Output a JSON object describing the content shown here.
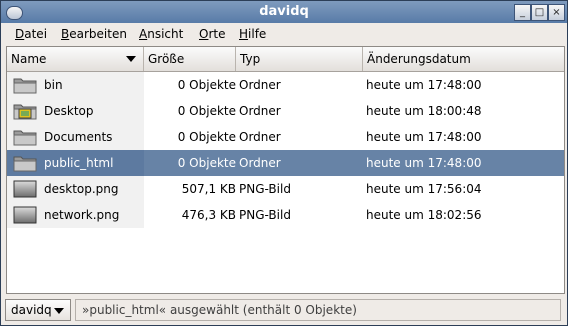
{
  "window": {
    "title": "davidq"
  },
  "menubar": [
    {
      "label": "Datei",
      "mnemonic": "D"
    },
    {
      "label": "Bearbeiten",
      "mnemonic": "B"
    },
    {
      "label": "Ansicht",
      "mnemonic": "A"
    },
    {
      "label": "Orte",
      "mnemonic": "O"
    },
    {
      "label": "Hilfe",
      "mnemonic": "H"
    }
  ],
  "columns": {
    "name": "Name",
    "size": "Größe",
    "type": "Typ",
    "date": "Änderungsdatum"
  },
  "files": [
    {
      "name": "bin",
      "size": "0 Objekte",
      "type": "Ordner",
      "date": "heute um 17:48:00",
      "icon": "folder-icon",
      "selected": false
    },
    {
      "name": "Desktop",
      "size": "0 Objekte",
      "type": "Ordner",
      "date": "heute um 18:00:48",
      "icon": "desktop-folder-icon",
      "selected": false
    },
    {
      "name": "Documents",
      "size": "0 Objekte",
      "type": "Ordner",
      "date": "heute um 17:48:00",
      "icon": "folder-icon",
      "selected": false
    },
    {
      "name": "public_html",
      "size": "0 Objekte",
      "type": "Ordner",
      "date": "heute um 17:48:00",
      "icon": "folder-icon",
      "selected": true
    },
    {
      "name": "desktop.png",
      "size": "507,1 KB",
      "type": "PNG-Bild",
      "date": "heute um 17:56:04",
      "icon": "image-file-icon",
      "selected": false
    },
    {
      "name": "network.png",
      "size": "476,3 KB",
      "type": "PNG-Bild",
      "date": "heute um 18:02:56",
      "icon": "image-file-icon",
      "selected": false
    }
  ],
  "statusbar": {
    "location": "davidq",
    "message": "»public_html« ausgewählt (enthält 0 Objekte)"
  },
  "colors": {
    "selection": "#6783a6",
    "titlebar": "#6b8ab2"
  }
}
